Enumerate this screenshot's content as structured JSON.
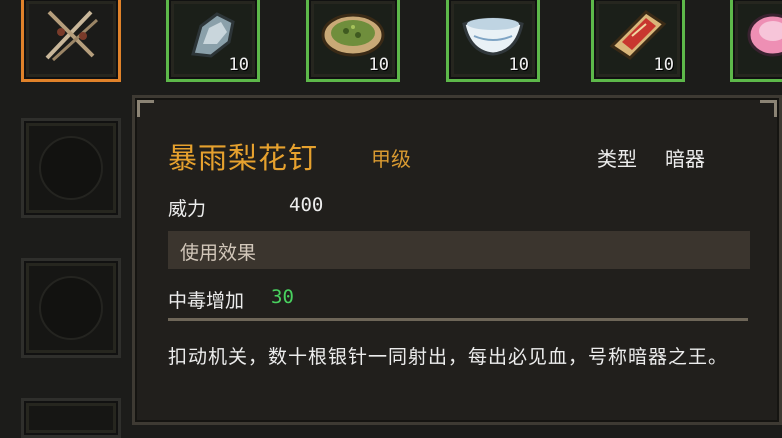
{
  "inventory": {
    "top_row": [
      {
        "item_icon": "crossed-needles-icon",
        "count": "",
        "selected": true
      },
      {
        "item_icon": "iron-ore-icon",
        "count": "10"
      },
      {
        "item_icon": "herbal-pancake-icon",
        "count": "10"
      },
      {
        "item_icon": "porcelain-bowl-icon",
        "count": "10"
      },
      {
        "item_icon": "red-scroll-box-icon",
        "count": "10"
      },
      {
        "item_icon": "pink-cake-icon",
        "count": ""
      }
    ],
    "colors": {
      "selected_border": "#e0822a",
      "stack_border": "#5db84a"
    }
  },
  "tooltip": {
    "name": "暴雨梨花钉",
    "grade": "甲级",
    "type_label": "类型",
    "type_value": "暗器",
    "power_label": "威力",
    "power_value": "400",
    "section_title": "使用效果",
    "effect_label": "中毒增加",
    "effect_value": "30",
    "description": "扣动机关，数十根银针一同射出，每出必见血，号称暗器之王。",
    "colors": {
      "name": "#e6a12e",
      "grade": "#d99a31",
      "effect_value": "#49d25f",
      "section_bar": "#3b352e"
    }
  }
}
